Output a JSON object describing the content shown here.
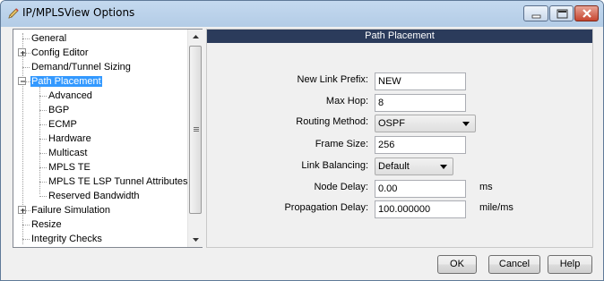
{
  "window": {
    "title": "IP/MPLSView Options",
    "app_icon": "pencil-icon",
    "controls": [
      "minimize-icon",
      "maximize-icon",
      "close-icon"
    ]
  },
  "tree": {
    "items": [
      {
        "label": "General"
      },
      {
        "label": "Config Editor"
      },
      {
        "label": "Demand/Tunnel Sizing"
      },
      {
        "label": "Path Placement",
        "selected": true
      },
      {
        "label": "Advanced"
      },
      {
        "label": "BGP"
      },
      {
        "label": "ECMP"
      },
      {
        "label": "Hardware"
      },
      {
        "label": "Multicast"
      },
      {
        "label": "MPLS TE"
      },
      {
        "label": "MPLS TE LSP Tunnel Attributes"
      },
      {
        "label": "Reserved Bandwidth"
      },
      {
        "label": "Failure Simulation"
      },
      {
        "label": "Resize"
      },
      {
        "label": "Integrity Checks"
      }
    ]
  },
  "panel": {
    "title": "Path Placement",
    "fields": {
      "new_link_prefix": {
        "label": "New Link Prefix:",
        "value": "NEW"
      },
      "max_hop": {
        "label": "Max Hop:",
        "value": "8"
      },
      "routing_method": {
        "label": "Routing Method:",
        "value": "OSPF"
      },
      "frame_size": {
        "label": "Frame Size:",
        "value": "256"
      },
      "link_balancing": {
        "label": "Link Balancing:",
        "value": "Default"
      },
      "node_delay": {
        "label": "Node Delay:",
        "value": "0.00",
        "unit": "ms"
      },
      "propagation_delay": {
        "label": "Propagation Delay:",
        "value": "100.000000",
        "unit": "mile/ms"
      }
    }
  },
  "buttons": {
    "ok": "OK",
    "cancel": "Cancel",
    "help": "Help"
  }
}
